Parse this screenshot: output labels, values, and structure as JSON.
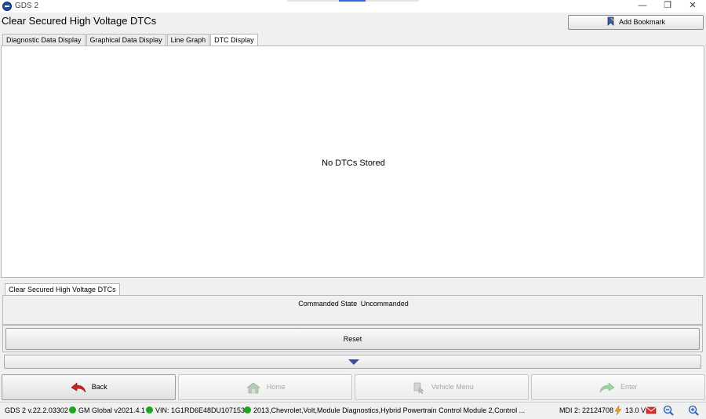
{
  "window": {
    "app_title": "GDS 2",
    "minimize_glyph": "—",
    "maximize_glyph": "❐",
    "close_glyph": "✕"
  },
  "header": {
    "page_title": "Clear Secured High Voltage DTCs",
    "bookmark_label": "Add Bookmark"
  },
  "tabs": [
    {
      "label": "Diagnostic Data Display",
      "active": false
    },
    {
      "label": "Graphical Data Display",
      "active": false
    },
    {
      "label": "Line Graph",
      "active": false
    },
    {
      "label": "DTC Display",
      "active": true
    }
  ],
  "main": {
    "empty_message": "No DTCs Stored"
  },
  "control": {
    "tab_label": "Clear Secured High Voltage DTCs",
    "commanded_label": "Commanded State",
    "commanded_value": "Uncommanded",
    "reset_label": "Reset"
  },
  "nav": {
    "back_label": "Back",
    "home_label": "Home",
    "vehicle_menu_label": "Vehicle Menu",
    "enter_label": "Enter"
  },
  "status": {
    "version": "GDS 2 v.22.2.03302",
    "gm_global": "GM Global v2021.4.1",
    "vin": "VIN: 1G1RD6E48DU107153",
    "vehicle": "2013,Chevrolet,Volt,Module Diagnostics,Hybrid Powertrain Control Module 2,Control ...",
    "mdi": "MDI 2: 22124708",
    "voltage": "13.0 V"
  },
  "colors": {
    "status_dot": "#1fa51f",
    "back_arrow": "#c62828",
    "expand_triangle": "#3d4f94",
    "accent_blue": "#2a6fd6"
  },
  "icons": [
    "app-logo-icon",
    "bookmark-icon",
    "back-arrow-icon",
    "home-icon",
    "vehicle-menu-icon",
    "enter-arrow-icon",
    "lightning-icon",
    "mail-icon",
    "zoom-out-icon",
    "zoom-in-icon",
    "chevron-down-icon"
  ]
}
